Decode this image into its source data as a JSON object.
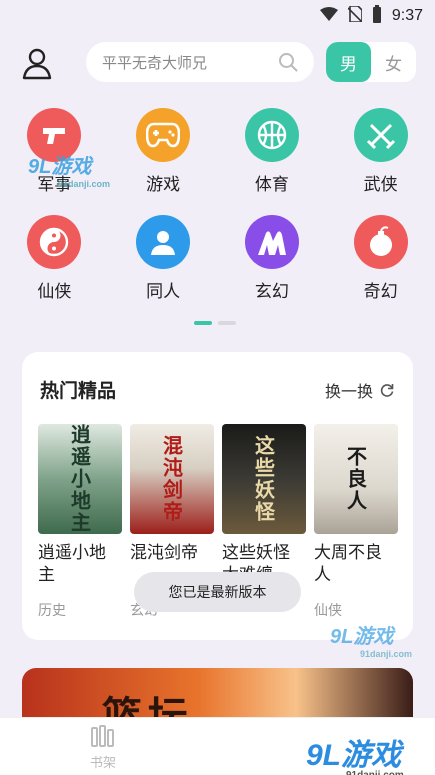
{
  "status_bar": {
    "time": "9:37"
  },
  "search": {
    "placeholder": "平平无奇大师兄"
  },
  "gender": {
    "male": "男",
    "female": "女"
  },
  "categories": [
    {
      "label": "军事",
      "icon": "pistol-icon",
      "color": "#ef5b5b"
    },
    {
      "label": "游戏",
      "icon": "gamepad-icon",
      "color": "#f5a22b"
    },
    {
      "label": "体育",
      "icon": "basketball-icon",
      "color": "#3ac6a6"
    },
    {
      "label": "武侠",
      "icon": "crossed-swords-icon",
      "color": "#3ac6a6"
    },
    {
      "label": "仙侠",
      "icon": "yin-yang-icon",
      "color": "#ef5b5b"
    },
    {
      "label": "同人",
      "icon": "person-icon",
      "color": "#2d9bea"
    },
    {
      "label": "玄幻",
      "icon": "mountain-icon",
      "color": "#8a4ee8"
    },
    {
      "label": "奇幻",
      "icon": "bomb-icon",
      "color": "#ef5b5b"
    }
  ],
  "hot": {
    "title": "热门精品",
    "refresh_label": "换一换",
    "books": [
      {
        "title": "逍遥小地主",
        "category": "历史",
        "cover_text": "逍遥小地主",
        "cover_color": "#5a8a6a"
      },
      {
        "title": "混沌剑帝",
        "category": "玄幻",
        "cover_text": "混沌剑帝",
        "cover_color": "#9c1f1a"
      },
      {
        "title": "这些妖怪太难缠",
        "category": "",
        "cover_text": "这些妖怪",
        "cover_color": "#2a2a28"
      },
      {
        "title": "大周不良人",
        "category": "仙侠",
        "cover_text": "不良人",
        "cover_color": "#d8d4cc"
      }
    ]
  },
  "toast": "您已是最新版本",
  "banner": {
    "text": "篮坛"
  },
  "tabbar": {
    "shelf_label": "书架"
  },
  "watermarks": {
    "main": "9L游戏",
    "url": "91danji.com"
  }
}
